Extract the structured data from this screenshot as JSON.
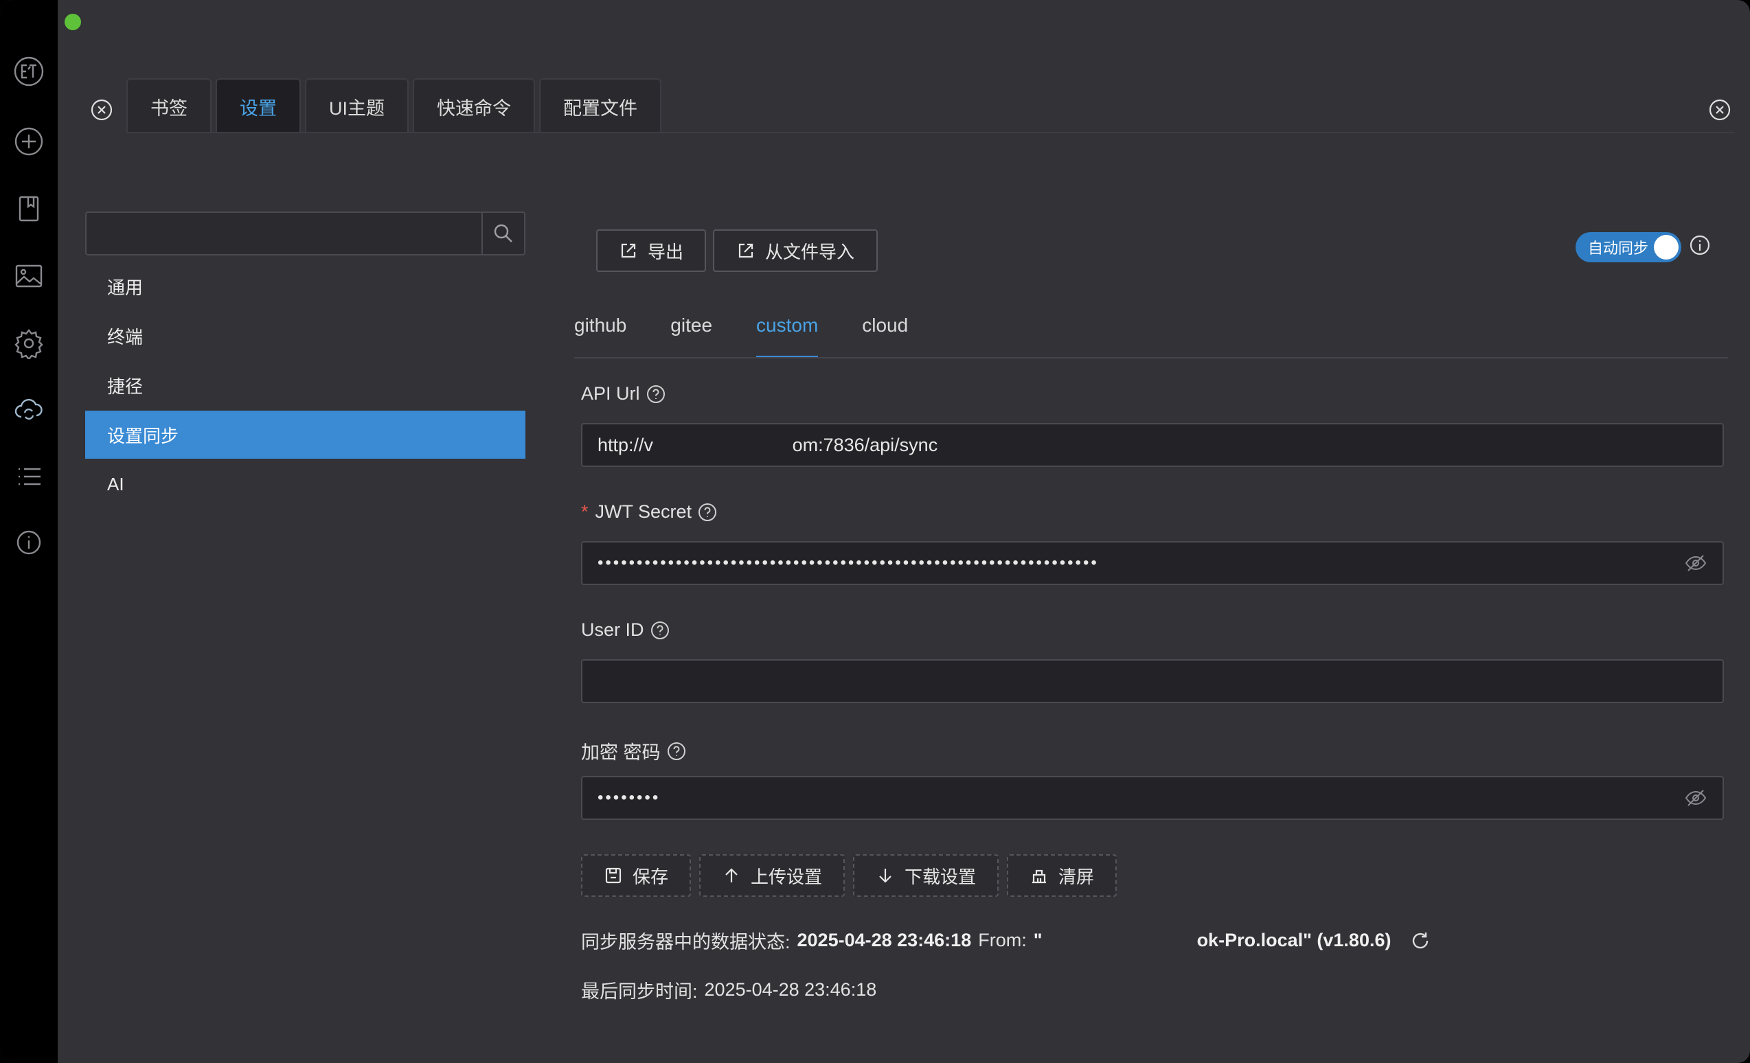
{
  "top_tabs": [
    "书签",
    "设置",
    "UI主题",
    "快速命令",
    "配置文件"
  ],
  "top_tabs_active": "设置",
  "search": {
    "value": "",
    "placeholder": ""
  },
  "nav": {
    "items": [
      "通用",
      "终端",
      "捷径",
      "设置同步",
      "AI"
    ],
    "active": "设置同步"
  },
  "toolbar": {
    "export_label": "导出",
    "import_label": "从文件导入"
  },
  "auto_sync": {
    "label": "自动同步",
    "enabled": true
  },
  "sync_tabs": [
    "github",
    "gitee",
    "custom",
    "cloud"
  ],
  "sync_tabs_active": "custom",
  "form": {
    "api_url": {
      "label": "API Url",
      "value": "http://v                           om:7836/api/sync"
    },
    "jwt_secret": {
      "label": "JWT Secret",
      "required": true,
      "value": "••••••••••••••••••••••••••••••••••••••••••••••••••••••••••••••••"
    },
    "user_id": {
      "label": "User ID",
      "value": ""
    },
    "encrypt_password": {
      "label": "加密 密码",
      "value": "••••••••"
    }
  },
  "actions": {
    "save_label": "保存",
    "upload_label": "上传设置",
    "download_label": "下载设置",
    "clear_label": "清屏"
  },
  "status": {
    "server_prefix": "同步服务器中的数据状态:",
    "server_time": "2025-04-28 23:46:18",
    "from_label": "From:",
    "from_value": "\"                              ok-Pro.local\" (v1.80.6)",
    "last_sync_label": "最后同步时间:",
    "last_sync_time": "2025-04-28 23:46:18"
  },
  "colors": {
    "accent": "#3a8ad4",
    "accent_text": "#4aa3e6",
    "background": "#323237",
    "sidebar": "#000000"
  },
  "sidebar_icons": [
    "logo-icon",
    "add-icon",
    "bookmark-icon",
    "image-icon",
    "settings-icon",
    "cloud-sync-icon",
    "list-icon",
    "info-icon"
  ]
}
